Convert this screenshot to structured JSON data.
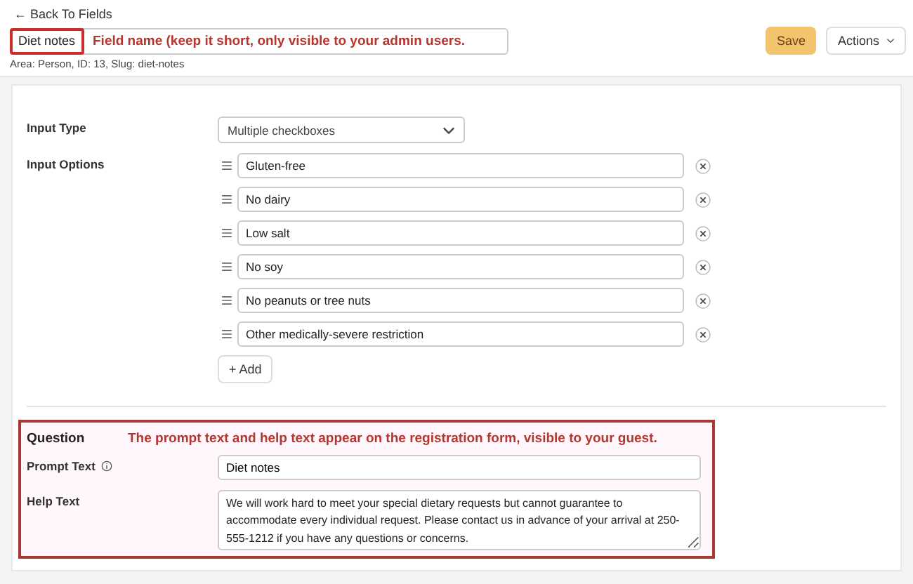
{
  "back_link": "← Back To Fields",
  "field_name": {
    "value": "Diet notes",
    "annotation": "Field name (keep it short, only visible to your admin users."
  },
  "meta": "Area: Person, ID: 13, Slug: diet-notes",
  "buttons": [
    {
      "label": "Save",
      "kind": "primary"
    },
    {
      "label": "Actions",
      "kind": "dropdown"
    }
  ],
  "input_type": {
    "label": "Input Type",
    "value": "Multiple checkboxes"
  },
  "input_options": {
    "label": "Input Options",
    "options": [
      "Gluten-free",
      "No dairy",
      "Low salt",
      "No soy",
      "No peanuts or tree nuts",
      "Other medically-severe restriction"
    ],
    "add_button": "+ Add"
  },
  "question": {
    "title": "Question",
    "annotation": "The prompt text and help text appear on the registration form, visible to your guest.",
    "prompt": {
      "label": "Prompt Text",
      "value": "Diet notes"
    },
    "help": {
      "label": "Help Text",
      "value": "We will work hard to meet your special dietary requests but cannot guarantee to accommodate every individual request. Please contact us in advance of your arrival at 250-555-1212 if you have any questions or concerns."
    }
  }
}
